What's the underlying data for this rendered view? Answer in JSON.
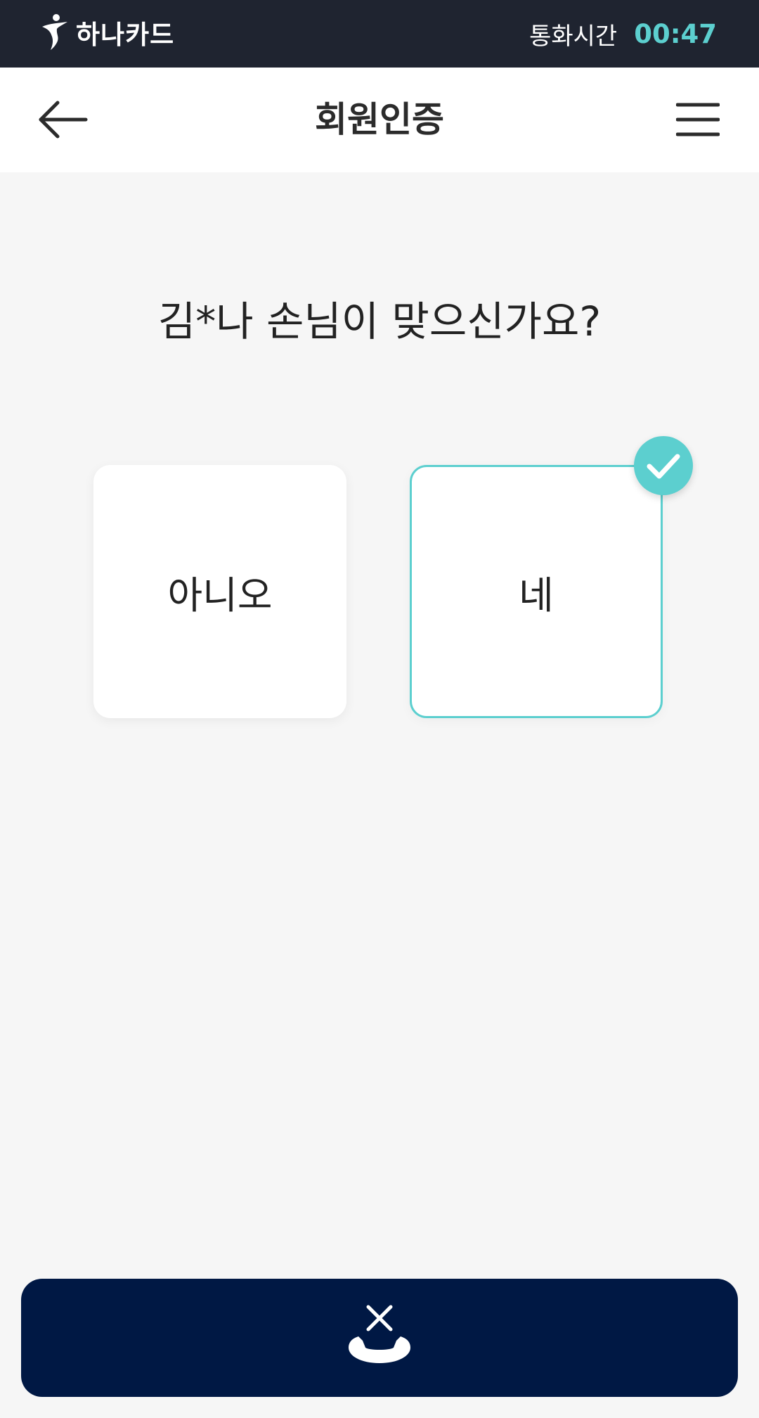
{
  "topbar": {
    "brand_name": "하나카드",
    "call_time_label": "통화시간",
    "call_time_value": "00:47",
    "accent_color": "#5ccfcf",
    "background_color": "#1f2430"
  },
  "header": {
    "title": "회원인증",
    "back_icon": "arrow-left-icon",
    "menu_icon": "hamburger-menu-icon"
  },
  "main": {
    "question": "김*나 손님이 맞으신가요?",
    "options": [
      {
        "label": "아니오",
        "selected": false
      },
      {
        "label": "네",
        "selected": true
      }
    ],
    "selected_color": "#5ccfcf"
  },
  "footer": {
    "hangup_icon": "end-call-icon",
    "button_color": "#001844"
  }
}
